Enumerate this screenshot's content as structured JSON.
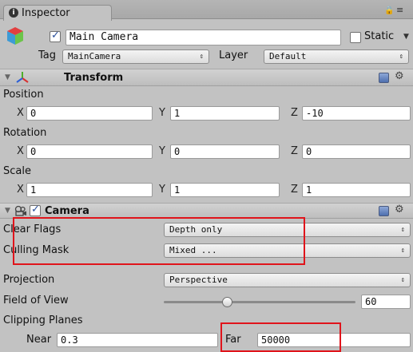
{
  "tab": {
    "label": "Inspector",
    "lock_icon": "lock-icon",
    "menu_icon": "menu-icon"
  },
  "object": {
    "icon": "cube-icon",
    "active": true,
    "name": "Main Camera",
    "static_label": "Static",
    "static_checked": false,
    "tag_label": "Tag",
    "tag_value": "MainCamera",
    "layer_label": "Layer",
    "layer_value": "Default"
  },
  "transform": {
    "title": "Transform",
    "icon": "transform-axes-icon",
    "position_label": "Position",
    "position": {
      "x": "0",
      "y": "1",
      "z": "-10"
    },
    "rotation_label": "Rotation",
    "rotation": {
      "x": "0",
      "y": "0",
      "z": "0"
    },
    "scale_label": "Scale",
    "scale": {
      "x": "1",
      "y": "1",
      "z": "1"
    },
    "axis_x": "X",
    "axis_y": "Y",
    "axis_z": "Z"
  },
  "camera": {
    "title": "Camera",
    "icon": "camera-icon",
    "enabled": true,
    "clear_flags_label": "Clear Flags",
    "clear_flags_value": "Depth only",
    "culling_mask_label": "Culling Mask",
    "culling_mask_value": "Mixed ...",
    "projection_label": "Projection",
    "projection_value": "Perspective",
    "fov_label": "Field of View",
    "fov_value": "60",
    "fov_slider_fraction": 0.333,
    "clipping_label": "Clipping Planes",
    "near_label": "Near",
    "near_value": "0.3",
    "far_label": "Far",
    "far_value": "50000"
  },
  "colors": {
    "highlight_border": "#e0141b",
    "panel_bg": "#c2c2c2"
  }
}
